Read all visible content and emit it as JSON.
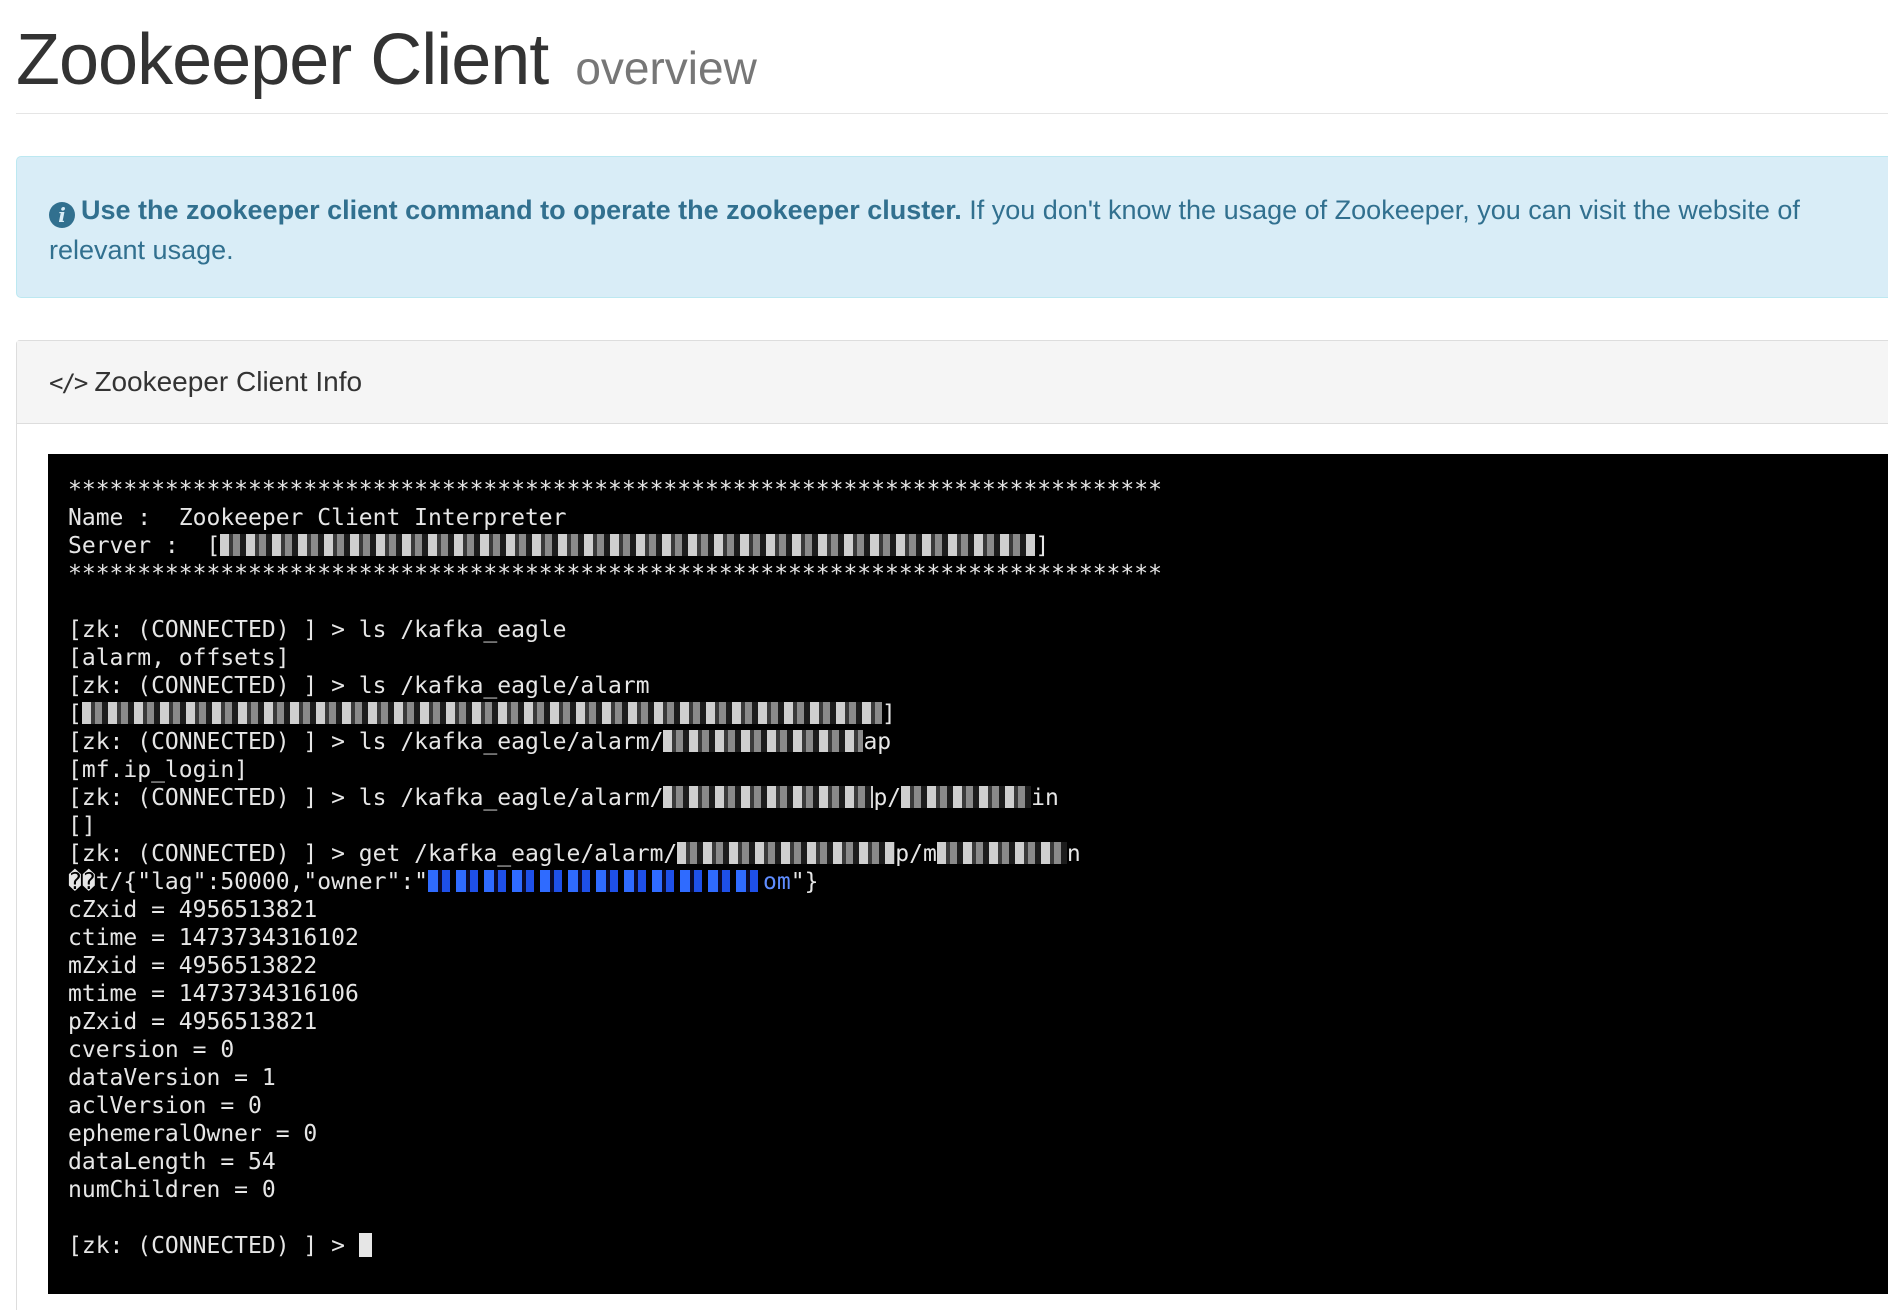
{
  "header": {
    "title": "Zookeeper Client",
    "subtitle": "overview"
  },
  "alert": {
    "bold_text": "Use the zookeeper client command to operate the zookeeper cluster.",
    "text_line1": " If you don't know the usage of Zookeeper, you can visit the website of",
    "text_line2": "relevant usage."
  },
  "panel": {
    "icon": "code-icon",
    "title": "Zookeeper Client Info"
  },
  "terminal": {
    "stars": "*******************************************************************************",
    "name_line": "Name :  Zookeeper Client Interpreter",
    "server_prefix": "Server :  [",
    "server_suffix": "]",
    "lines": [
      "[zk: (CONNECTED) ] > ls /kafka_eagle",
      "[alarm, offsets]",
      "[zk: (CONNECTED) ] > ls /kafka_eagle/alarm"
    ],
    "redacted_list_prefix": "[",
    "redacted_list_suffix": "]",
    "ls_alarm_child_prefix": "[zk: (CONNECTED) ] > ls /kafka_eagle/alarm/",
    "ls_alarm_child_suffix": "ap",
    "mf_login": "[mf.ip_login]",
    "ls_deep_prefix": "[zk: (CONNECTED) ] > ls /kafka_eagle/alarm/",
    "ls_deep_mid": "p/",
    "ls_deep_suffix": "in",
    "empty_list": "[]",
    "get_prefix": "[zk: (CONNECTED) ] > get /kafka_eagle/alarm/",
    "get_mid": "p/m",
    "get_suffix": "n",
    "data_prefix": "��t/{\"lag\":50000,\"owner\":\"",
    "data_link_suffix": "om",
    "data_suffix": "\"}",
    "stats": [
      "cZxid = 4956513821",
      "ctime = 1473734316102",
      "mZxid = 4956513822",
      "mtime = 1473734316106",
      "pZxid = 4956513821",
      "cversion = 0",
      "dataVersion = 1",
      "aclVersion = 0",
      "ephemeralOwner = 0",
      "dataLength = 54",
      "numChildren = 0"
    ],
    "prompt": "[zk: (CONNECTED) ] > "
  }
}
